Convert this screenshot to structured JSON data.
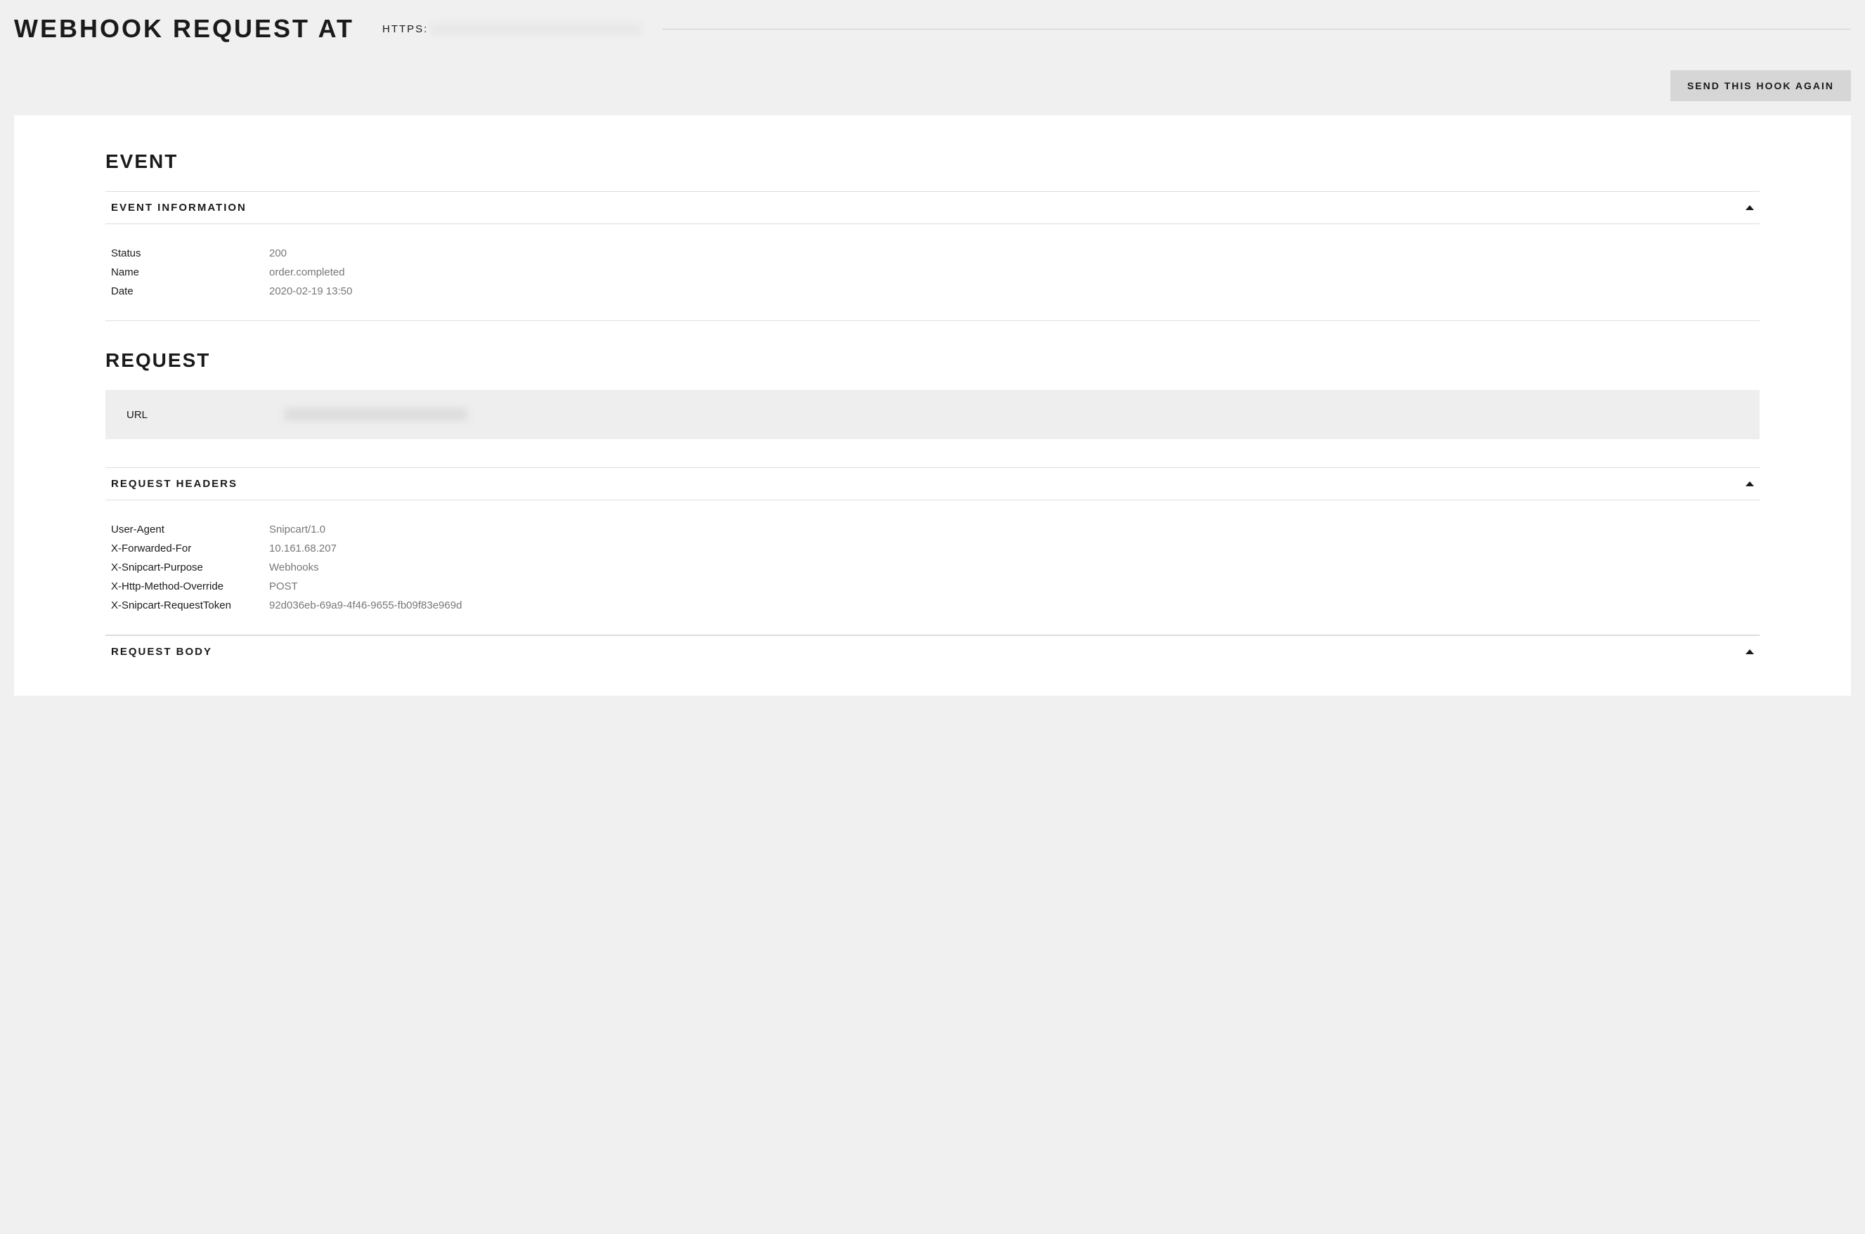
{
  "header": {
    "title": "WEBHOOK REQUEST AT",
    "url_prefix": "HTTPS:"
  },
  "actions": {
    "send_again": "SEND THIS HOOK AGAIN"
  },
  "event": {
    "section_title": "EVENT",
    "info_header": "EVENT INFORMATION",
    "fields": {
      "status_label": "Status",
      "status_value": "200",
      "name_label": "Name",
      "name_value": "order.completed",
      "date_label": "Date",
      "date_value": "2020-02-19 13:50"
    }
  },
  "request": {
    "section_title": "REQUEST",
    "url_label": "URL",
    "headers_title": "REQUEST HEADERS",
    "headers": [
      {
        "key": "User-Agent",
        "value": "Snipcart/1.0"
      },
      {
        "key": "X-Forwarded-For",
        "value": "10.161.68.207"
      },
      {
        "key": "X-Snipcart-Purpose",
        "value": "Webhooks"
      },
      {
        "key": "X-Http-Method-Override",
        "value": "POST"
      },
      {
        "key": "X-Snipcart-RequestToken",
        "value": "92d036eb-69a9-4f46-9655-fb09f83e969d"
      }
    ],
    "body_title": "REQUEST BODY"
  }
}
